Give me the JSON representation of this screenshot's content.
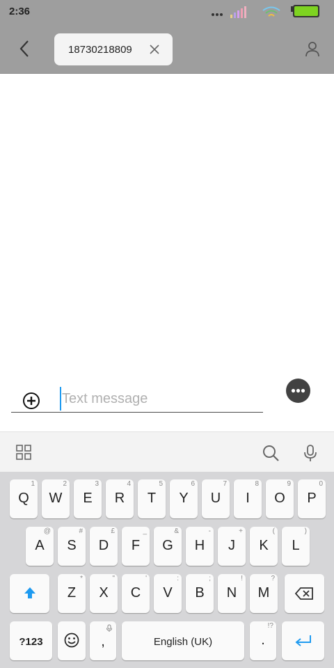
{
  "status_bar": {
    "time": "2:36"
  },
  "recipient": {
    "number": "18730218809"
  },
  "composer": {
    "placeholder": "Text message"
  },
  "keyboard": {
    "row1": [
      {
        "key": "Q",
        "hint": "1"
      },
      {
        "key": "W",
        "hint": "2"
      },
      {
        "key": "E",
        "hint": "3"
      },
      {
        "key": "R",
        "hint": "4"
      },
      {
        "key": "T",
        "hint": "5"
      },
      {
        "key": "Y",
        "hint": "6"
      },
      {
        "key": "U",
        "hint": "7"
      },
      {
        "key": "I",
        "hint": "8"
      },
      {
        "key": "O",
        "hint": "9"
      },
      {
        "key": "P",
        "hint": "0"
      }
    ],
    "row2": [
      {
        "key": "A",
        "hint": "@"
      },
      {
        "key": "S",
        "hint": "#"
      },
      {
        "key": "D",
        "hint": "£"
      },
      {
        "key": "F",
        "hint": "_"
      },
      {
        "key": "G",
        "hint": "&"
      },
      {
        "key": "H",
        "hint": "-"
      },
      {
        "key": "J",
        "hint": "+"
      },
      {
        "key": "K",
        "hint": "("
      },
      {
        "key": "L",
        "hint": ")"
      }
    ],
    "row3": [
      {
        "key": "Z",
        "hint": "*"
      },
      {
        "key": "X",
        "hint": "\""
      },
      {
        "key": "C",
        "hint": "'"
      },
      {
        "key": "V",
        "hint": ":"
      },
      {
        "key": "B",
        "hint": ";"
      },
      {
        "key": "N",
        "hint": "!"
      },
      {
        "key": "M",
        "hint": "?"
      }
    ],
    "symbols_label": "?123",
    "comma_label": ",",
    "space_label": "English (UK)",
    "period_label": ".",
    "period_hint": "!?"
  },
  "colors": {
    "header_bg": "#9e9e9e",
    "accent": "#1e9af0",
    "battery": "#7ed321"
  }
}
